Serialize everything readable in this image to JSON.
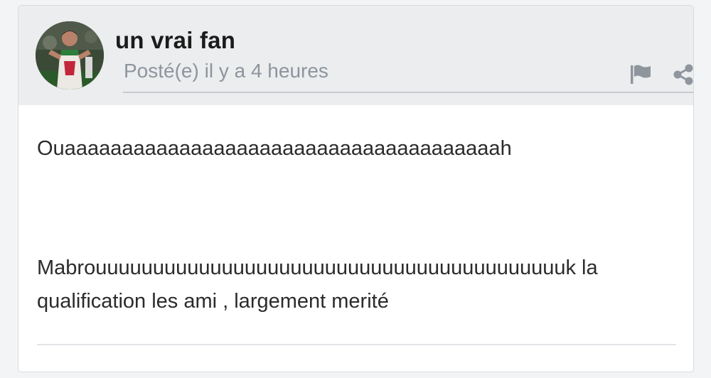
{
  "post": {
    "author": "un vrai fan",
    "meta": "Posté(e) il y a 4 heures",
    "body": [
      "Ouaaaaaaaaaaaaaaaaaaaaaaaaaaaaaaaaaaaaaah",
      "Mabrouuuuuuuuuuuuuuuuuuuuuuuuuuuuuuuuuuuuuuuuuk la qualification les ami , largement merité"
    ]
  },
  "icons": {
    "flag": "flag-icon",
    "share": "share-icon"
  },
  "colors": {
    "header_bg": "#ebedef",
    "meta_text": "#8e959d",
    "icon_gray": "#8e959d"
  }
}
